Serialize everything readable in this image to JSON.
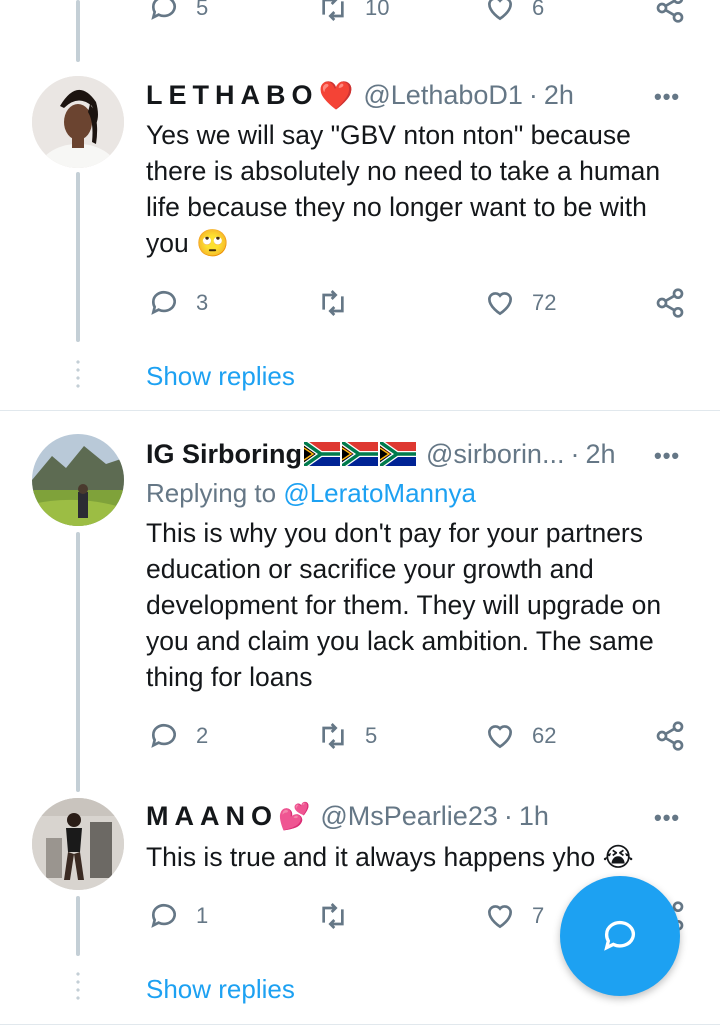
{
  "top_partial_actions": {
    "reply_count": "5",
    "retweet_count": "10",
    "like_count": "6"
  },
  "tweets": [
    {
      "display_name": "LETHABO",
      "name_emoji": "❤️",
      "handle": "@LethaboD1",
      "time": "2h",
      "text": "Yes we will say \"GBV nton nton\" because there is absolutely no need to take a human life because they no longer want to be with you",
      "text_emoji": "🙄",
      "replies": "3",
      "retweets": "",
      "likes": "72"
    },
    {
      "display_name": "IG Sirboring",
      "handle": "@sirborin...",
      "time": "2h",
      "replying_to_label": "Replying to",
      "replying_to_handle": "@LeratoMannya",
      "text": "This is why you don't pay for your partners education or sacrifice your growth and development for them. They will upgrade on you and claim you lack ambition. The same thing for loans",
      "replies": "2",
      "retweets": "5",
      "likes": "62"
    },
    {
      "display_name": "MAANO",
      "name_emoji": "💕",
      "handle": "@MsPearlie23",
      "time": "1h",
      "text": "This is true and it always happens yho",
      "text_emoji": "😭",
      "replies": "1",
      "retweets": "",
      "likes": "7"
    }
  ],
  "show_replies_label": "Show replies",
  "more_label": "•••",
  "separator": "·",
  "colors": {
    "accent": "#1da1f2",
    "muted": "#657786",
    "text": "#14171a",
    "thread_line": "#c4cfd6"
  }
}
